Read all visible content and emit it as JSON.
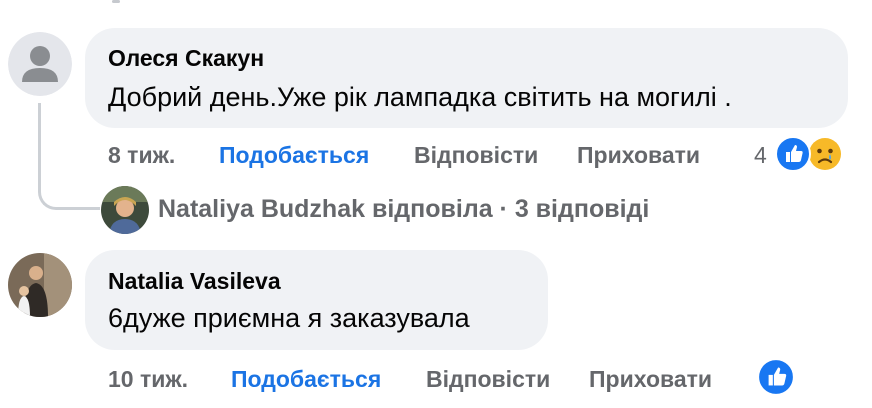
{
  "comments": [
    {
      "author": "Олеся Скакун",
      "text": "Добрий день.Уже рік лампадка світить на могилі .",
      "time": "8 тиж.",
      "like_label": "Подобається",
      "reply_label": "Відповісти",
      "hide_label": "Приховати",
      "reaction_count": "4",
      "reactions": [
        "like-icon",
        "sad-icon"
      ]
    },
    {
      "author": "Natalia Vasileva",
      "text": "6дуже приємна я заказувала",
      "time": "10 тиж.",
      "like_label": "Подобається",
      "reply_label": "Відповісти",
      "hide_label": "Приховати",
      "reactions": [
        "like-icon"
      ]
    }
  ],
  "reply_summary": {
    "text": "Nataliya Budzhak відповіла · 3 відповіді"
  },
  "colors": {
    "bubble": "#f0f2f5",
    "like_blue": "#1b74e4",
    "meta_gray": "#65676b"
  }
}
